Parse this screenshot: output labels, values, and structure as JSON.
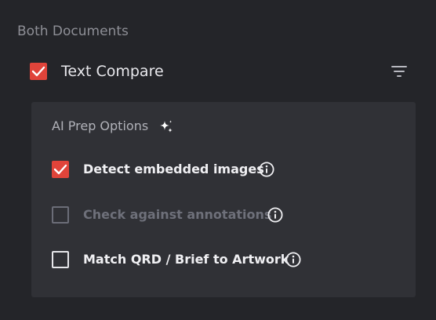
{
  "section": {
    "label": "Both Documents"
  },
  "text_compare": {
    "label": "Text Compare",
    "checked": true,
    "filter_icon": "filter-icon"
  },
  "ai_prep": {
    "title": "AI Prep Options",
    "title_icon": "sparkle-icon",
    "options": [
      {
        "label": "Detect embedded images",
        "checked": true,
        "disabled": false,
        "icon": "info-icon"
      },
      {
        "label": "Check against annotations",
        "checked": false,
        "disabled": true,
        "icon": "info-icon"
      },
      {
        "label": "Match QRD / Brief to Artwork",
        "checked": false,
        "disabled": false,
        "icon": "info-icon"
      }
    ]
  },
  "colors": {
    "background": "#242529",
    "panel": "#303136",
    "accent": "#e0443a"
  }
}
